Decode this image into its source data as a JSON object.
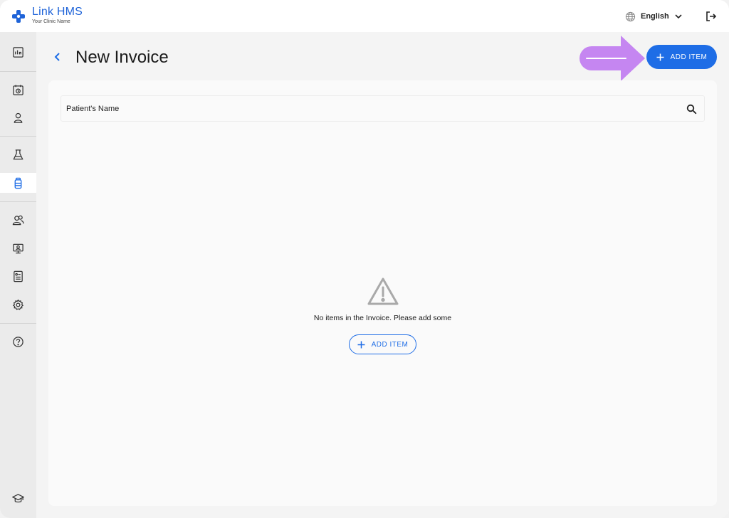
{
  "brand": {
    "name_part1": "Link",
    "name_part2": "HMS",
    "subtitle": "Your Clinic Name",
    "color": "#1e63d8"
  },
  "header": {
    "language": "English",
    "language_icon": "globe-icon",
    "logout_icon": "logout-icon"
  },
  "sidebar": {
    "items": [
      {
        "icon": "dashboard-icon",
        "active": false
      },
      {
        "icon": "appointments-icon",
        "active": false
      },
      {
        "icon": "patients-icon",
        "active": false
      },
      {
        "icon": "lab-icon",
        "active": false
      },
      {
        "icon": "pharmacy-icon",
        "active": true
      },
      {
        "icon": "staff-icon",
        "active": false
      },
      {
        "icon": "monitor-icon",
        "active": false
      },
      {
        "icon": "reports-icon",
        "active": false
      },
      {
        "icon": "settings-icon",
        "active": false
      },
      {
        "icon": "help-icon",
        "active": false
      },
      {
        "icon": "education-icon",
        "active": false
      }
    ]
  },
  "page": {
    "title": "New Invoice",
    "add_item_label": "ADD ITEM"
  },
  "search": {
    "placeholder": "Patient's Name"
  },
  "empty_state": {
    "message": "No items in the Invoice. Please add some",
    "button_label": "ADD ITEM"
  },
  "colors": {
    "accent": "#1e6de6",
    "highlight_arrow": "#c07cf0"
  }
}
